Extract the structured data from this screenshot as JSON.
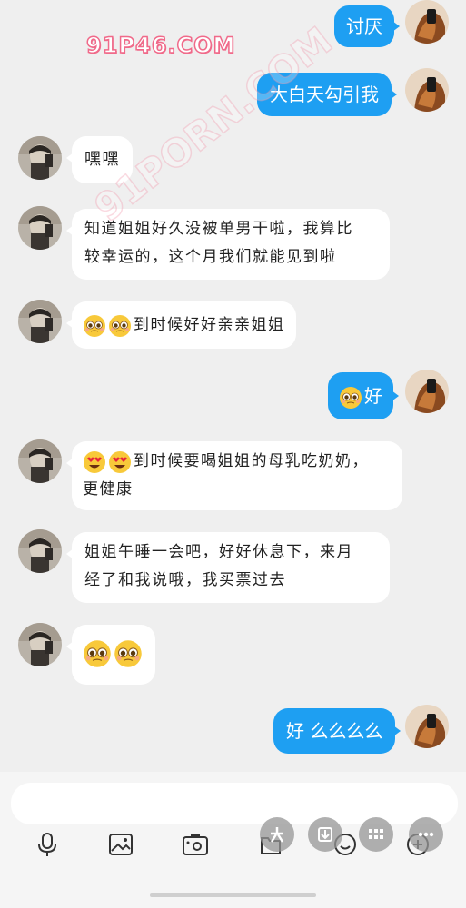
{
  "watermark": {
    "top_text": "91P46.COM",
    "diagonal_text": "91PORN.COM"
  },
  "messages": [
    {
      "side": "out",
      "text": "讨厌"
    },
    {
      "side": "out",
      "text": "大白天勾引我"
    },
    {
      "side": "in",
      "text": "嘿嘿"
    },
    {
      "side": "in",
      "text": "知道姐姐好久没被单男干啦，我算比较幸运的，这个月我们就能见到啦",
      "line1": "知道姐姐好久没被单男干啦，我算比",
      "line2": "较幸运的，这个月我们就能见到啦"
    },
    {
      "side": "in",
      "text": "到时候好好亲亲姐姐",
      "emojis": [
        "pleading-emoji",
        "pleading-emoji"
      ]
    },
    {
      "side": "out",
      "text": "好",
      "emojis": [
        "pleading-emoji"
      ]
    },
    {
      "side": "in",
      "text": "到时候要喝姐姐的母乳吃奶奶，更健康",
      "line1": "到时候要喝姐姐的母乳吃奶奶，",
      "line2": "更健康",
      "emojis": [
        "heart-eyes-emoji",
        "heart-eyes-emoji"
      ]
    },
    {
      "side": "in",
      "text": "姐姐午睡一会吧，好好休息下，来月经了和我说哦，我买票过去",
      "line1": "姐姐午睡一会吧，好好休息下，来月",
      "line2": "经了和我说哦，我买票过去"
    },
    {
      "side": "in",
      "text": "",
      "emojis": [
        "pleading-emoji",
        "pleading-emoji"
      ]
    },
    {
      "side": "out",
      "text": "好 么么么么"
    }
  ],
  "input": {
    "value": "",
    "placeholder": ""
  },
  "toolbar": {
    "icons": [
      "microphone-icon",
      "image-icon",
      "camera-icon",
      "folder-icon",
      "emoji-icon",
      "more-icon"
    ]
  },
  "floating_buttons": [
    "six-icon",
    "download-icon",
    "grid-icon",
    "ellipsis-icon"
  ],
  "colors": {
    "background": "#efefef",
    "outgoing_bubble": "#1e9ff2",
    "incoming_bubble": "#ffffff",
    "watermark_pink": "#f06a8a"
  }
}
